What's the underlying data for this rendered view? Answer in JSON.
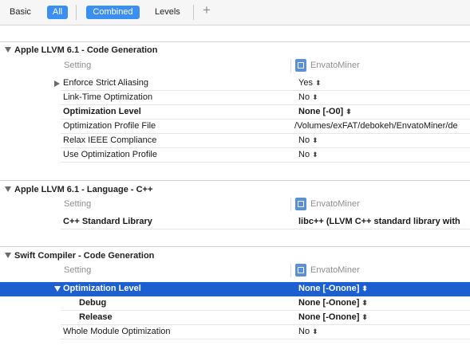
{
  "toolbar": {
    "basic": "Basic",
    "all": "All",
    "combined": "Combined",
    "levels": "Levels",
    "add": "+"
  },
  "column_setting": "Setting",
  "target_name": "EnvatoMiner",
  "sections": [
    {
      "title": "Apple LLVM 6.1 - Code Generation",
      "rows": [
        {
          "name": "Enforce Strict Aliasing",
          "value": "Yes"
        },
        {
          "name": "Link-Time Optimization",
          "value": "No"
        },
        {
          "name": "Optimization Level",
          "value": "None [-O0]"
        },
        {
          "name": "Optimization Profile File",
          "value": "/Volumes/exFAT/debokeh/EnvatoMiner/de"
        },
        {
          "name": "Relax IEEE Compliance",
          "value": "No"
        },
        {
          "name": "Use Optimization Profile",
          "value": "No"
        }
      ]
    },
    {
      "title": "Apple LLVM 6.1 - Language - C++",
      "rows": [
        {
          "name": "C++ Standard Library",
          "value": "libc++ (LLVM C++ standard library with"
        }
      ]
    },
    {
      "title": "Swift Compiler - Code Generation",
      "rows": [
        {
          "name": "Optimization Level",
          "value": "None [-Onone]"
        },
        {
          "name": "Debug",
          "value": "None [-Onone]"
        },
        {
          "name": "Release",
          "value": "None [-Onone]"
        },
        {
          "name": "Whole Module Optimization",
          "value": "No"
        }
      ]
    }
  ],
  "colors": {
    "selection": "#1b5fd1",
    "toolbar_selected": "#3b8ff0"
  },
  "icons": {
    "stepper": "⌃⌄ up-down chevrons",
    "disclosure": "triangle"
  }
}
